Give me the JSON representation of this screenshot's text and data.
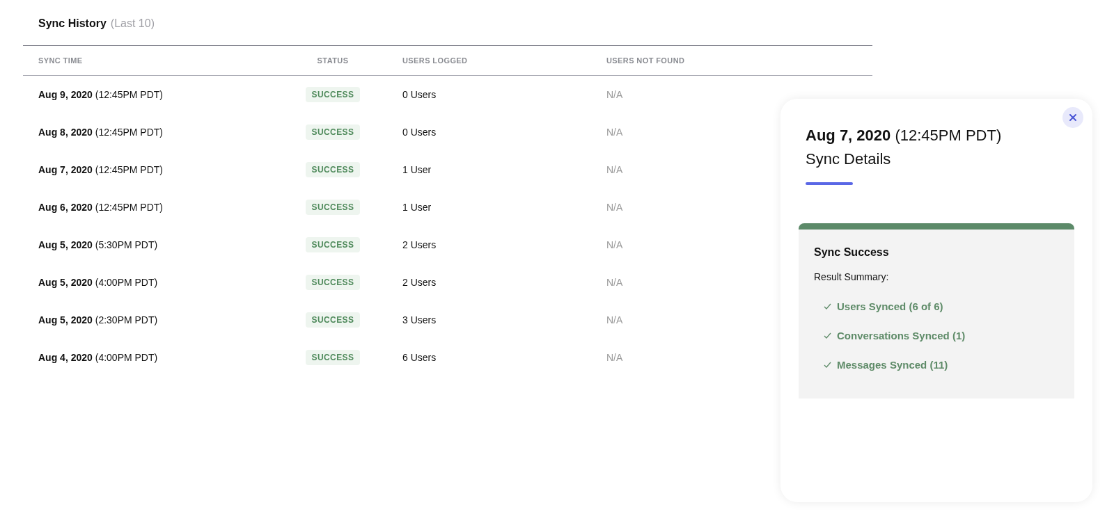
{
  "history": {
    "title": "Sync History",
    "subtitle": "(Last 10)",
    "columns": [
      "SYNC TIME",
      "STATUS",
      "USERS LOGGED",
      "USERS NOT FOUND"
    ],
    "rows": [
      {
        "sync_time": "**Aug 9, 2020** (12:45PM PDT)",
        "status": "SUCCESS",
        "users_logged": "0 Users",
        "users_not_found": "N/A"
      },
      {
        "sync_time": "**Aug 8, 2020** (12:45PM PDT)",
        "status": "SUCCESS",
        "users_logged": "0 Users",
        "users_not_found": "N/A"
      },
      {
        "sync_time": "**Aug 7, 2020** (12:45PM PDT)",
        "status": "SUCCESS",
        "users_logged": "1 User",
        "users_not_found": "N/A"
      },
      {
        "sync_time": "**Aug 6, 2020** (12:45PM PDT)",
        "status": "SUCCESS",
        "users_logged": "1 User",
        "users_not_found": "N/A"
      },
      {
        "sync_time": "**Aug 5, 2020** (5:30PM PDT)",
        "status": "SUCCESS",
        "users_logged": "2 Users",
        "users_not_found": "N/A"
      },
      {
        "sync_time": "**Aug 5, 2020** (4:00PM PDT)",
        "status": "SUCCESS",
        "users_logged": "2 Users",
        "users_not_found": "N/A"
      },
      {
        "sync_time": "**Aug 5, 2020** (2:30PM PDT)",
        "status": "SUCCESS",
        "users_logged": "3 Users",
        "users_not_found": "N/A"
      },
      {
        "sync_time": "**Aug 4, 2020** (4:00PM PDT)",
        "status": "SUCCESS",
        "users_logged": "6 Users",
        "users_not_found": "N/A"
      }
    ]
  },
  "details_panel": {
    "date": "**Aug 7, 2020** (12:45PM PDT)",
    "title": "Sync Details",
    "result_card": {
      "heading": "Sync Success",
      "summary_label": "Result Summary:",
      "items": [
        "Users Synced (6 of 6)",
        "Conversations Synced (1)",
        "Messages Synced (11)"
      ]
    }
  }
}
